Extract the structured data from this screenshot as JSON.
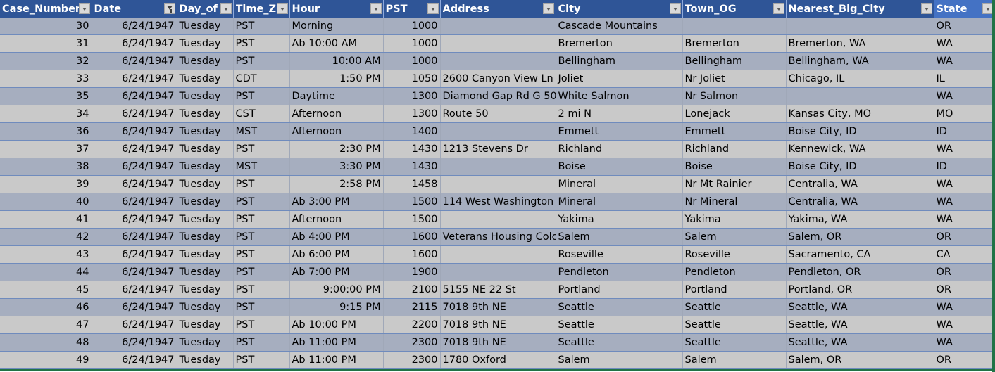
{
  "columns": [
    {
      "label": "Case_Number",
      "filtered": false
    },
    {
      "label": "Date",
      "filtered": true
    },
    {
      "label": "Day_of",
      "filtered": false
    },
    {
      "label": "Time_Z",
      "filtered": false
    },
    {
      "label": "Hour",
      "filtered": false
    },
    {
      "label": "PST",
      "filtered": false
    },
    {
      "label": "Address",
      "filtered": false
    },
    {
      "label": "City",
      "filtered": false
    },
    {
      "label": "Town_OG",
      "filtered": false
    },
    {
      "label": "Nearest_Big_City",
      "filtered": false
    },
    {
      "label": "State",
      "filtered": false
    }
  ],
  "rows": [
    {
      "case": "30",
      "date": "6/24/1947",
      "day": "Tuesday",
      "tz": "PST",
      "hour": "Morning",
      "hour_num": false,
      "pst": "1000",
      "address": "",
      "city": "Cascade Mountains",
      "town": "",
      "nearest": "",
      "state": "OR"
    },
    {
      "case": "31",
      "date": "6/24/1947",
      "day": "Tuesday",
      "tz": "PST",
      "hour": "Ab 10:00 AM",
      "hour_num": false,
      "pst": "1000",
      "address": "",
      "city": "Bremerton",
      "town": "Bremerton",
      "nearest": "Bremerton, WA",
      "state": "WA"
    },
    {
      "case": "32",
      "date": "6/24/1947",
      "day": "Tuesday",
      "tz": "PST",
      "hour": "10:00 AM",
      "hour_num": true,
      "pst": "1000",
      "address": "",
      "city": "Bellingham",
      "town": "Bellingham",
      "nearest": "Bellingham, WA",
      "state": "WA"
    },
    {
      "case": "33",
      "date": "6/24/1947",
      "day": "Tuesday",
      "tz": "CDT",
      "hour": "1:50 PM",
      "hour_num": true,
      "pst": "1050",
      "address": "2600 Canyon View Ln",
      "city": "Joliet",
      "town": "Nr Joliet",
      "nearest": "Chicago, IL",
      "state": "IL"
    },
    {
      "case": "35",
      "date": "6/24/1947",
      "day": "Tuesday",
      "tz": "PST",
      "hour": "Daytime",
      "hour_num": false,
      "pst": "1300",
      "address": "Diamond Gap Rd G 50",
      "city": "White Salmon",
      "town": "Nr Salmon",
      "nearest": "",
      "state": "WA"
    },
    {
      "case": "34",
      "date": "6/24/1947",
      "day": "Tuesday",
      "tz": "CST",
      "hour": "Afternoon",
      "hour_num": false,
      "pst": "1300",
      "address": "Route 50",
      "city": " 2 mi N",
      "town": "Lonejack",
      "nearest": "Kansas City, MO",
      "state": "MO"
    },
    {
      "case": "36",
      "date": "6/24/1947",
      "day": "Tuesday",
      "tz": "MST",
      "hour": "Afternoon",
      "hour_num": false,
      "pst": "1400",
      "address": "",
      "city": "Emmett",
      "town": "Emmett",
      "nearest": "Boise City, ID",
      "state": "ID"
    },
    {
      "case": "37",
      "date": "6/24/1947",
      "day": "Tuesday",
      "tz": "PST",
      "hour": "2:30 PM",
      "hour_num": true,
      "pst": "1430",
      "address": "1213 Stevens Dr",
      "city": "Richland",
      "town": "Richland",
      "nearest": "Kennewick, WA",
      "state": "WA"
    },
    {
      "case": "38",
      "date": "6/24/1947",
      "day": "Tuesday",
      "tz": "MST",
      "hour": "3:30 PM",
      "hour_num": true,
      "pst": "1430",
      "address": "",
      "city": "Boise",
      "town": "Boise",
      "nearest": "Boise City, ID",
      "state": "ID"
    },
    {
      "case": "39",
      "date": "6/24/1947",
      "day": "Tuesday",
      "tz": "PST",
      "hour": "2:58 PM",
      "hour_num": true,
      "pst": "1458",
      "address": "",
      "city": "Mineral",
      "town": "Nr Mt Rainier",
      "nearest": "Centralia, WA",
      "state": "WA"
    },
    {
      "case": "40",
      "date": "6/24/1947",
      "day": "Tuesday",
      "tz": "PST",
      "hour": "Ab 3:00 PM",
      "hour_num": false,
      "pst": "1500",
      "address": "114 West Washington",
      "city": "Mineral",
      "town": "Nr Mineral",
      "nearest": "Centralia, WA",
      "state": "WA"
    },
    {
      "case": "41",
      "date": "6/24/1947",
      "day": "Tuesday",
      "tz": "PST",
      "hour": "Afternoon",
      "hour_num": false,
      "pst": "1500",
      "address": "",
      "city": "Yakima",
      "town": "Yakima",
      "nearest": "Yakima, WA",
      "state": "WA"
    },
    {
      "case": "42",
      "date": "6/24/1947",
      "day": "Tuesday",
      "tz": "PST",
      "hour": "Ab 4:00 PM",
      "hour_num": false,
      "pst": "1600",
      "address": "Veterans Housing Colony",
      "city": "Salem",
      "town": "Salem",
      "nearest": "Salem, OR",
      "state": "OR"
    },
    {
      "case": "43",
      "date": "6/24/1947",
      "day": "Tuesday",
      "tz": "PST",
      "hour": "Ab 6:00 PM",
      "hour_num": false,
      "pst": "1600",
      "address": "",
      "city": "Roseville",
      "town": "Roseville",
      "nearest": "Sacramento, CA",
      "state": "CA"
    },
    {
      "case": "44",
      "date": "6/24/1947",
      "day": "Tuesday",
      "tz": "PST",
      "hour": "Ab 7:00 PM",
      "hour_num": false,
      "pst": "1900",
      "address": "",
      "city": "Pendleton",
      "town": "Pendleton",
      "nearest": "Pendleton, OR",
      "state": "OR"
    },
    {
      "case": "45",
      "date": "6/24/1947",
      "day": "Tuesday",
      "tz": "PST",
      "hour": "9:00:00 PM",
      "hour_num": true,
      "pst": "2100",
      "address": "5155 NE 22 St",
      "city": "Portland",
      "town": "Portland",
      "nearest": "Portland, OR",
      "state": "OR"
    },
    {
      "case": "46",
      "date": "6/24/1947",
      "day": "Tuesday",
      "tz": "PST",
      "hour": "9:15 PM",
      "hour_num": true,
      "pst": "2115",
      "address": "7018 9th NE",
      "city": "Seattle",
      "town": "Seattle",
      "nearest": "Seattle, WA",
      "state": "WA"
    },
    {
      "case": "47",
      "date": "6/24/1947",
      "day": "Tuesday",
      "tz": "PST",
      "hour": "Ab 10:00 PM",
      "hour_num": false,
      "pst": "2200",
      "address": "7018 9th NE",
      "city": "Seattle",
      "town": "Seattle",
      "nearest": "Seattle, WA",
      "state": "WA"
    },
    {
      "case": "48",
      "date": "6/24/1947",
      "day": "Tuesday",
      "tz": "PST",
      "hour": "Ab 11:00 PM",
      "hour_num": false,
      "pst": "2300",
      "address": "7018 9th NE",
      "city": "Seattle",
      "town": "Seattle",
      "nearest": "Seattle, WA",
      "state": "WA"
    },
    {
      "case": "49",
      "date": "6/24/1947",
      "day": "Tuesday",
      "tz": "PST",
      "hour": "Ab 11:00 PM",
      "hour_num": false,
      "pst": "2300",
      "address": "1780 Oxford",
      "city": "Salem",
      "town": "Salem",
      "nearest": "Salem, OR",
      "state": "OR"
    }
  ]
}
